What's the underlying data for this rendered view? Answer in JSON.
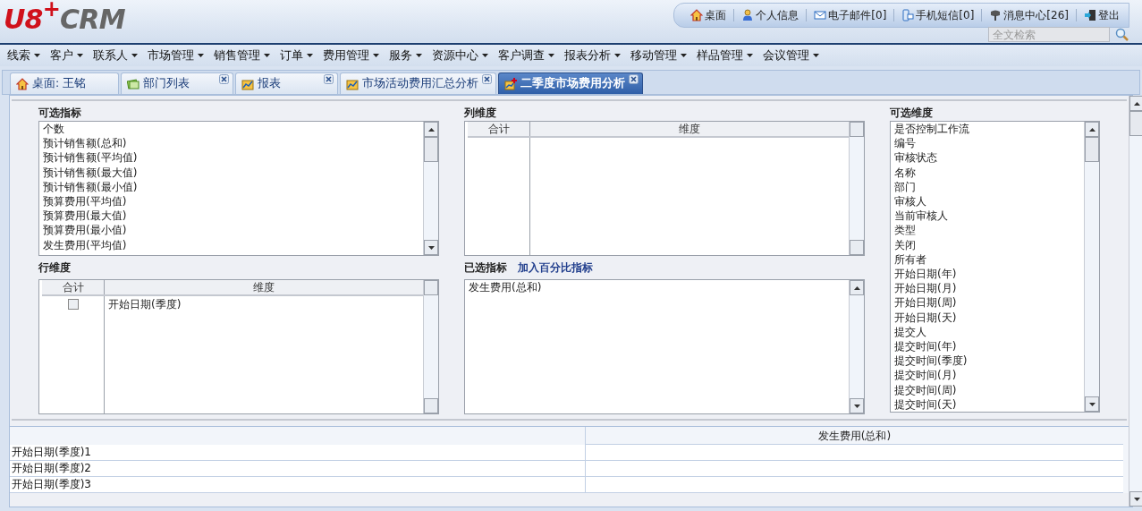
{
  "logo": [
    "U8",
    "+",
    "CRM"
  ],
  "top_links": [
    "桌面",
    "个人信息",
    "电子邮件[0]",
    "手机短信[0]",
    "消息中心[26]",
    "登出"
  ],
  "search": {
    "placeholder": "全文检索"
  },
  "menu": [
    "线索",
    "客户",
    "联系人",
    "市场管理",
    "销售管理",
    "订单",
    "费用管理",
    "服务",
    "资源中心",
    "客户调查",
    "报表分析",
    "移动管理",
    "样品管理",
    "会议管理"
  ],
  "tabs": [
    {
      "label": "桌面: 王铭",
      "selected": false,
      "closable": false
    },
    {
      "label": "部门列表",
      "selected": false,
      "closable": true
    },
    {
      "label": "报表",
      "selected": false,
      "closable": true
    },
    {
      "label": "市场活动费用汇总分析",
      "selected": false,
      "closable": true
    },
    {
      "label": "二季度市场费用分析",
      "selected": true,
      "closable": true
    }
  ],
  "available_metrics": {
    "title": "可选指标",
    "items": [
      "个数",
      "预计销售额(总和)",
      "预计销售额(平均值)",
      "预计销售额(最大值)",
      "预计销售额(最小值)",
      "预算费用(平均值)",
      "预算费用(最大值)",
      "预算费用(最小值)",
      "发生费用(平均值)"
    ]
  },
  "column_dimensions": {
    "title": "列维度",
    "columns": [
      "合计",
      "维度"
    ]
  },
  "available_dimensions": {
    "title": "可选维度",
    "items": [
      "是否控制工作流",
      "编号",
      "审核状态",
      "名称",
      "部门",
      "审核人",
      "当前审核人",
      "类型",
      "关闭",
      "所有者",
      "开始日期(年)",
      "开始日期(月)",
      "开始日期(周)",
      "开始日期(天)",
      "提交人",
      "提交时间(年)",
      "提交时间(季度)",
      "提交时间(月)",
      "提交时间(周)",
      "提交时间(天)"
    ]
  },
  "row_dimensions": {
    "title": "行维度",
    "columns": [
      "合计",
      "维度"
    ],
    "rows": [
      {
        "label": "开始日期(季度)",
        "checked": false
      }
    ]
  },
  "selected_metrics": {
    "title": "已选指标",
    "link": "加入百分比指标",
    "items": [
      "发生费用(总和)"
    ]
  },
  "result_table": {
    "column_2": "发生费用(总和)",
    "rows": [
      "开始日期(季度)1",
      "开始日期(季度)2",
      "开始日期(季度)3"
    ]
  }
}
